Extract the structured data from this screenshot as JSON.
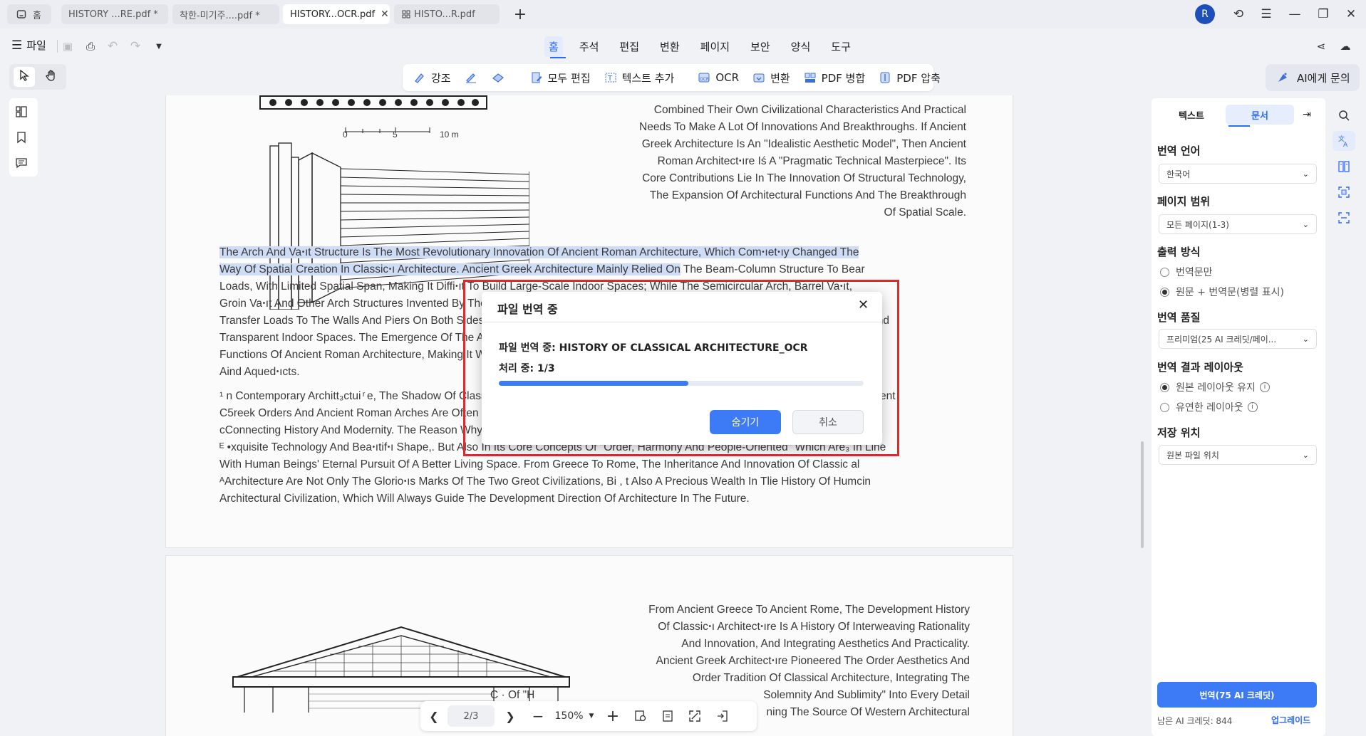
{
  "tabs": [
    {
      "label": "홈",
      "icon": "home-icon"
    },
    {
      "label": "HISTORY ...RE.pdf *"
    },
    {
      "label": "착한-미기주....pdf *"
    },
    {
      "label": "HISTORY...OCR.pdf",
      "active": true
    },
    {
      "label": "HISTO...R.pdf",
      "icon": "grid-icon"
    }
  ],
  "user_initial": "R",
  "menubar": {
    "file_label": "파일",
    "tabs": [
      "홈",
      "주석",
      "편집",
      "변환",
      "페이지",
      "보안",
      "양식",
      "도구"
    ],
    "active_tab": "홈"
  },
  "toolbar": {
    "highlight": "강조",
    "edit_all": "모두 편집",
    "add_text": "텍스트 추가",
    "ocr": "OCR",
    "convert": "변환",
    "merge": "PDF 병합",
    "compress": "PDF 압축"
  },
  "ask_ai": "AI에게 문의",
  "page1": {
    "scale_labels": [
      "0",
      "5",
      "10 m"
    ],
    "right_para": [
      "Combined Their Own Civilizational Characteristics And Practical",
      "Needs To Make A Lot Of Innovations And Breakthroughs. If Ancient",
      "Greek Architecture Is An \"Idealistic Aesthetic Model\", Then Ancient",
      "Roman Architectꞏıre Iś A \"Pragmatic Technical Masterpiece\". Its",
      "Core Contributions Lie In The Innovation Of Structural Technology,",
      "The Expansion Of Architectural Functions And The Breakthrough",
      "Of Spatial Scale."
    ],
    "hl_line1": "The Arch And Vaꞏıt Structure Is The Most Revolutionary Innovation Of Ancient Roman Architecture, Which Comꞏıetꞏıy Changed The",
    "hl_line2a": "Way Of Spatial Creation In Classicꞏı Architecture. Ancient Greek Architecture Mainly Relied On",
    "hl_line2b": " The Beam-Column Structure To Bear",
    "body_lines": [
      "Loads, With Limited Spatial Span, Making It Diffiꞏıt To Build Large-Scale Indoor Spaces; While The Semicircular Arch, Barrel Vaꞏıt,",
      "Groin Vaꞏıt And Other Arch Structures Invented By The Ancient Romans Can Effectively Disperse The Weight Of The Roof And Evenly",
      "Transfer Loads To The Walls And Piers On Both Sides, Thus Creating A Huge Column-Free Space Compared To The Previous Open And",
      "Transparent Indoor Spaces. The Emergence Of The Arch Structure Enabled Ancient Roman Architecture To Realize Complex Space",
      "Functions Of Ancient Roman Architecture, Making It Widely Used In Public Buildings Such As Baths, Basilicas, Amphitheaters, Paths",
      "Aind Aquedꞏıcts."
    ],
    "footnote_lines": [
      "¹ n Contemporary Architt₃ctui ͬ e, The Shadow Of Classical Architecture Can Still Be Seen Everywhere And Has Been Regarded As Ancient",
      "C5reek Orders And Ancient Roman Arches Are Often Used As Design Elements In Modern Buildings, Becoming An Important Bridge",
      "cConnecting History And Modernity. The Reason Why Classical Architecture Has Such Lasting Vitality Lies Not Only In Its",
      "ᴱ •xquisite Technology And Beaꞏıtifꞏı Shape,. But Also In Its Core Concepts Of \"Order, Harmony And People-Oriented\" Which Are₃ In Line",
      "With Human Beings' Eternal Pursuit Of A Better Living Space. From Greece To Rome, The Inheritance And Innovation Of Classic   al",
      "ᴬArchitecture Are Not Only The Glorioꞏıs Marks Of The Two Greot Civilizations, Bi , t Also A Precious Wealth In Tlie History Of Humcin",
      "Architectural Civilization, Which Will Always Guide The Development Direction Of Architecture In The Future."
    ]
  },
  "page2": {
    "right_para": [
      "From Ancient Greece To Ancient Rome, The Development History",
      "Of Classicꞏı Architectꞏıre Is A History Of Interweaving Rationality",
      "And Innovation, And Integrating Aesthetics And Practicality.",
      "Ancient Greek Architectꞏıre Pioneered The Order Aesthetics And",
      "Order Tradition Of Classical Architecture, Integrating The",
      "Solemnity And Sublimity\" Into Every Detail",
      "ning The Source Of Western Architectural"
    ],
    "partial_prefix": "C    ·  Of \"H"
  },
  "dialog": {
    "title": "파일 번역 중",
    "file_line": "파일 번역 중: HISTORY OF CLASSICAL ARCHITECTURE_OCR",
    "processing_line": "처리 중: 1/3",
    "progress": 0.52,
    "hide_btn": "숨기기",
    "cancel_btn": "취소"
  },
  "right_panel": {
    "tab_text": "텍스트",
    "tab_doc": "문서",
    "lang_label": "번역 언어",
    "lang_value": "한국어",
    "range_label": "페이지 범위",
    "range_value": "모든 페이지(1-3)",
    "output_label": "출력 방식",
    "output_opt1": "번역문만",
    "output_opt2": "원문 + 번역문(병렬 표시)",
    "quality_label": "번역 품질",
    "quality_value": "프리미엄(25 AI 크레딧/페이...",
    "layout_label": "번역 결과 레이아웃",
    "layout_opt1": "원본 레이아웃 유지",
    "layout_opt2": "유연한 레이아웃",
    "save_label": "저장 위치",
    "save_value": "원본 파일 위치",
    "translate_btn": "번역(75 AI 크레딧)",
    "credits": "남은 AI 크레딧: 844",
    "upgrade": "업그레이드"
  },
  "bottom_nav": {
    "page": "2/3",
    "zoom": "150%"
  },
  "colors": {
    "accent": "#3d7af5",
    "highlight": "#cfdcf5",
    "annotation_red": "#e02a2a"
  }
}
